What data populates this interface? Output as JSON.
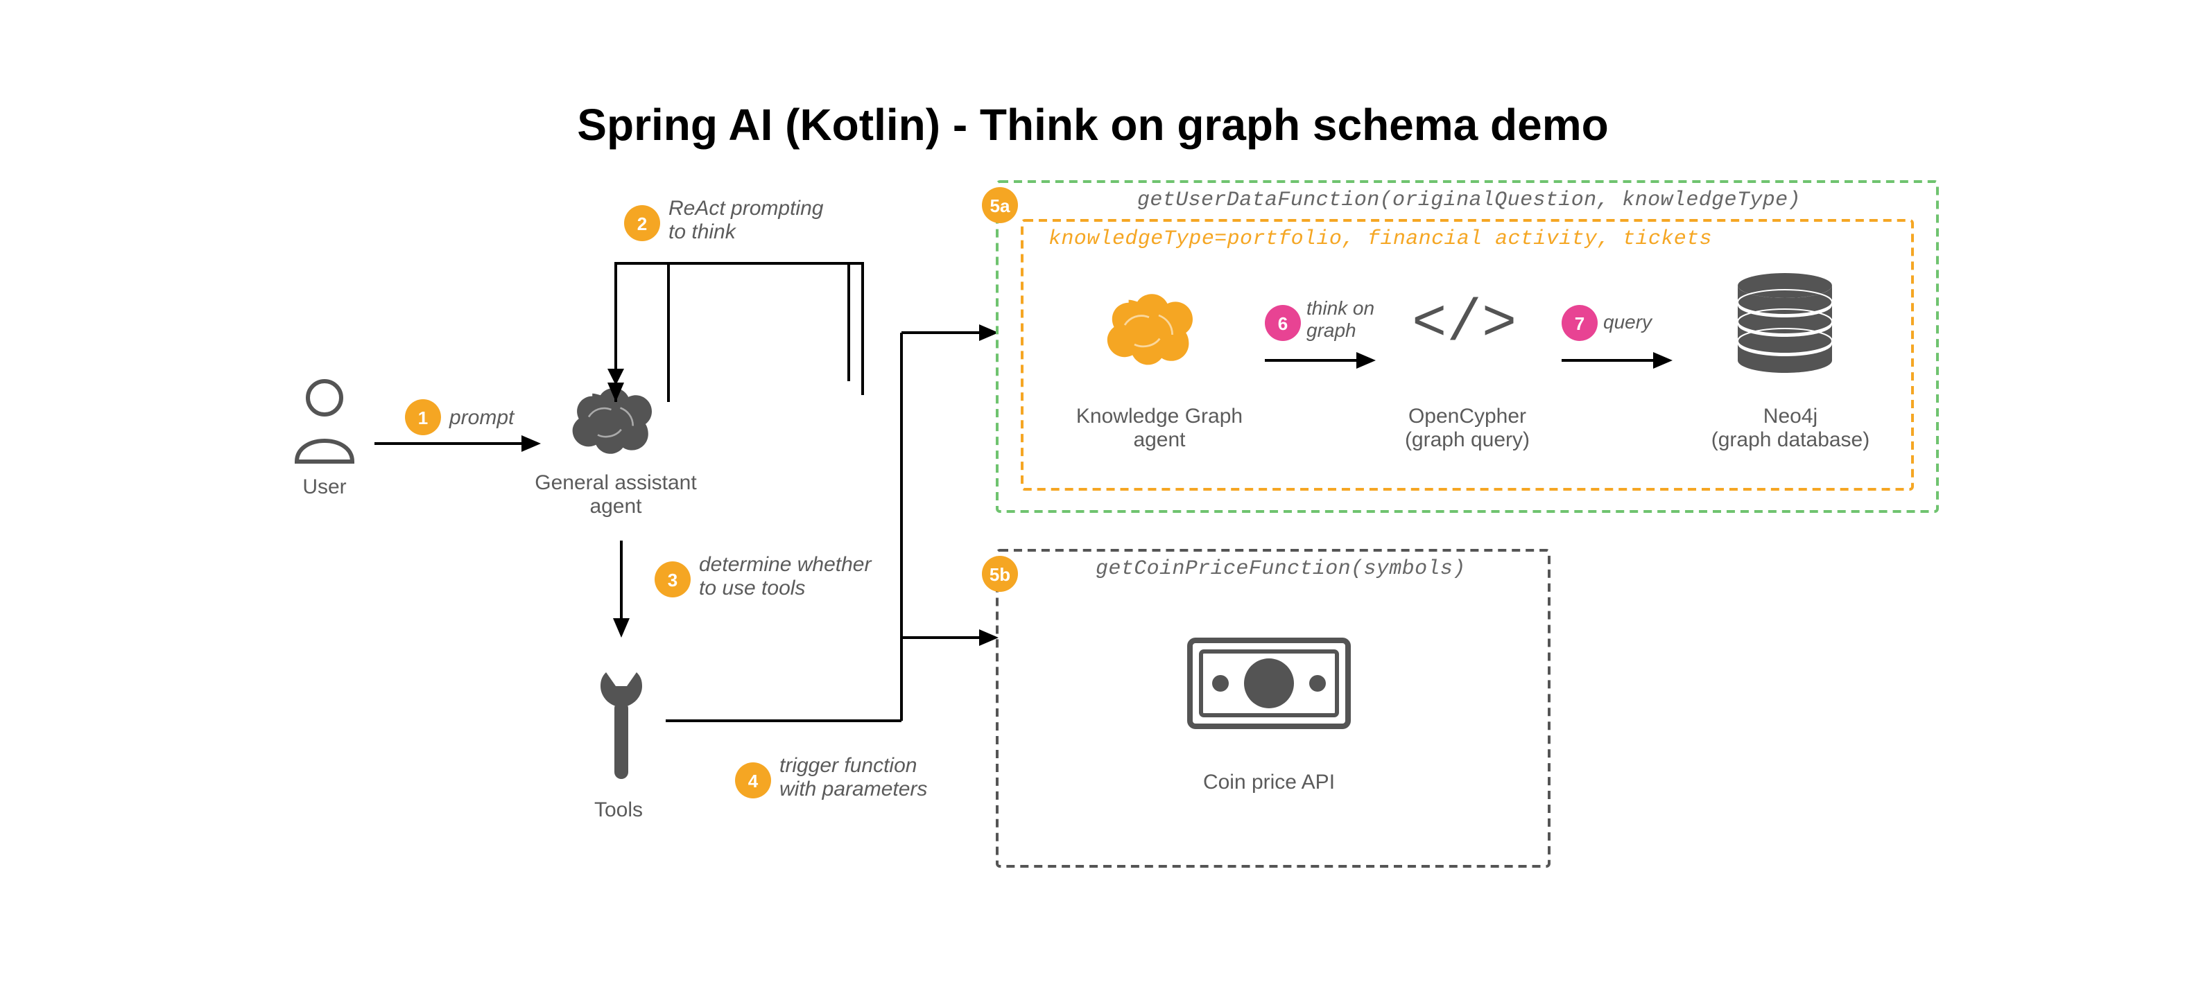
{
  "title": "Spring AI (Kotlin) - Think on graph schema demo",
  "nodes": {
    "user": {
      "label": "User"
    },
    "assistant": {
      "label": "General assistant\nagent"
    },
    "tools": {
      "label": "Tools"
    },
    "kg_agent": {
      "label": "Knowledge Graph\nagent"
    },
    "opencypher": {
      "label": "OpenCypher\n(graph query)"
    },
    "neo4j": {
      "label": "Neo4j\n(graph database)"
    },
    "coin_api": {
      "label": "Coin price API"
    }
  },
  "steps": {
    "s1": {
      "num": "1",
      "text": "prompt"
    },
    "s2": {
      "num": "2",
      "text": "ReAct prompting\nto think"
    },
    "s3": {
      "num": "3",
      "text": "determine whether\nto use tools"
    },
    "s4": {
      "num": "4",
      "text": "trigger function\nwith parameters"
    },
    "s5a": {
      "num": "5a",
      "text": "getUserDataFunction(originalQuestion, knowledgeType)"
    },
    "s5a_inner": {
      "text": "knowledgeType=portfolio, financial activity, tickets"
    },
    "s5b": {
      "num": "5b",
      "text": "getCoinPriceFunction(symbols)"
    },
    "s6": {
      "num": "6",
      "text": "think on\ngraph"
    },
    "s7": {
      "num": "7",
      "text": "query"
    }
  },
  "colors": {
    "orange": "#f5a623",
    "pink": "#e84393",
    "green": "#6fc36f",
    "gray": "#545454"
  }
}
